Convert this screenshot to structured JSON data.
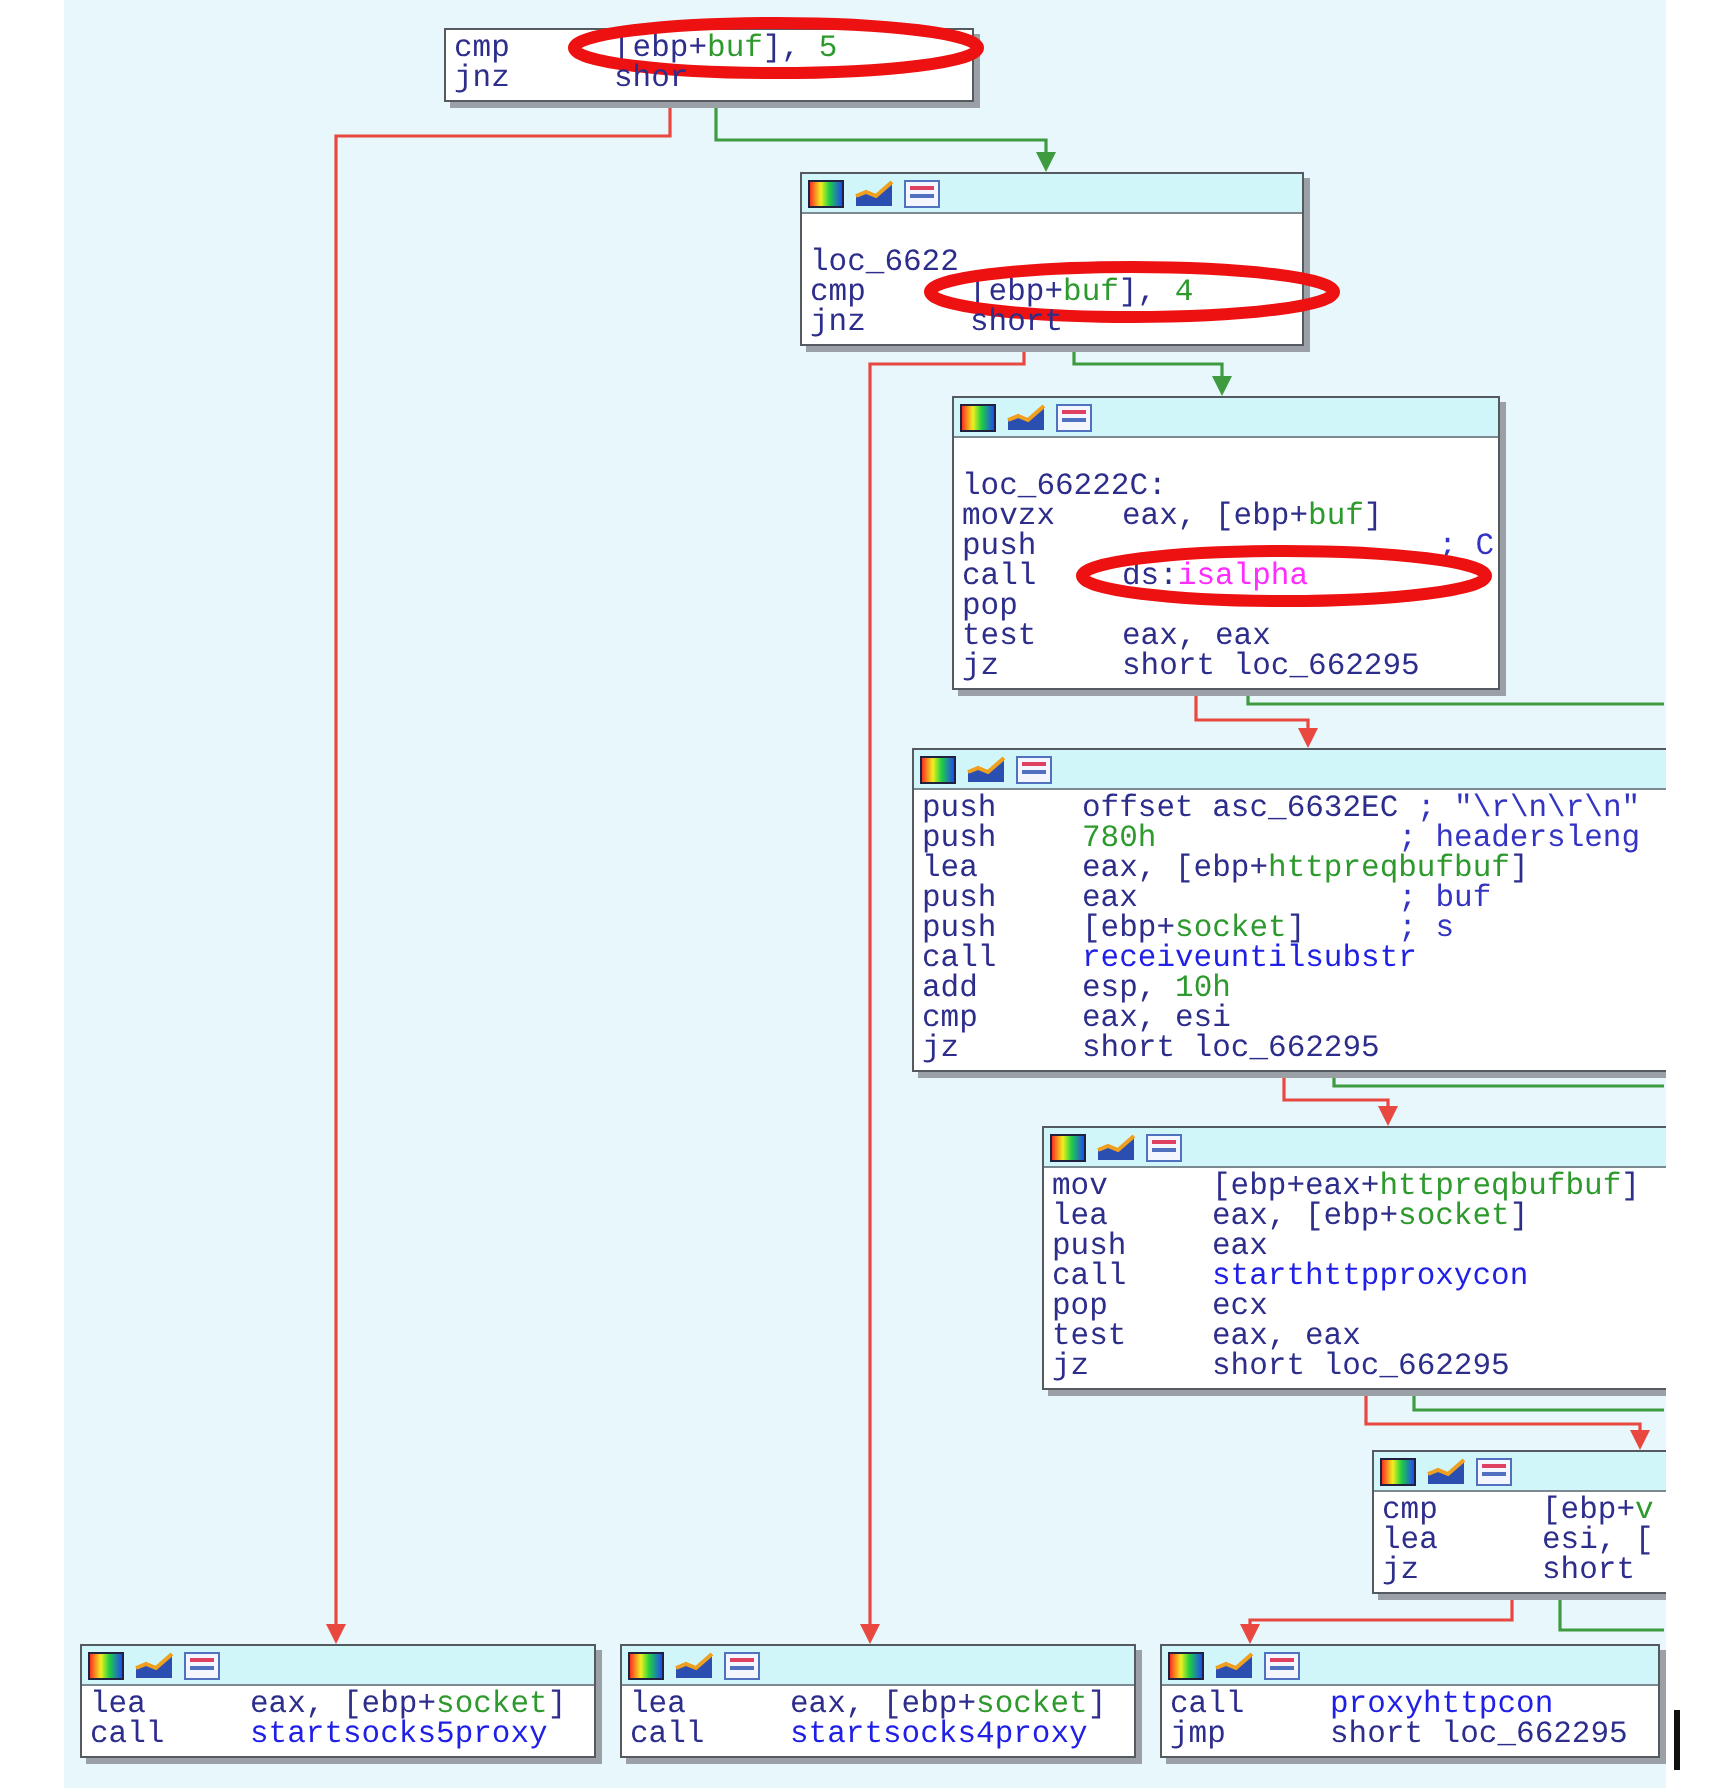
{
  "blocks": [
    {
      "header": false,
      "lines": [
        {
          "kind": "instr",
          "m": "cmp",
          "op": [
            {
              "t": "[ebp+",
              "kind": "reg"
            },
            {
              "t": "buf",
              "kind": "var"
            },
            {
              "t": "], ",
              "kind": "reg"
            },
            {
              "t": "5",
              "kind": "num"
            }
          ],
          "circled": true
        },
        {
          "kind": "instr",
          "m": "jnz",
          "op": [
            {
              "t": "shor",
              "kind": "reg"
            }
          ],
          "circled": false
        }
      ]
    },
    {
      "header": true,
      "lines": [
        {
          "kind": "blank"
        },
        {
          "kind": "label",
          "text": "loc_6622",
          "circled": false
        },
        {
          "kind": "instr",
          "m": "cmp",
          "op": [
            {
              "t": "[ebp+",
              "kind": "reg"
            },
            {
              "t": "buf",
              "kind": "var"
            },
            {
              "t": "], ",
              "kind": "reg"
            },
            {
              "t": "4",
              "kind": "num"
            }
          ],
          "circled": true
        },
        {
          "kind": "instr",
          "m": "jnz",
          "op": [
            {
              "t": "short",
              "kind": "reg"
            }
          ],
          "circled": false
        }
      ]
    },
    {
      "header": true,
      "lines": [
        {
          "kind": "blank"
        },
        {
          "kind": "label",
          "text": "loc_66222C:",
          "circled": false
        },
        {
          "kind": "instr",
          "m": "movzx",
          "op": [
            {
              "t": "eax, [ebp+",
              "kind": "reg"
            },
            {
              "t": "buf",
              "kind": "var"
            },
            {
              "t": "]",
              "kind": "reg"
            }
          ],
          "circled": false
        },
        {
          "kind": "instr",
          "m": "push",
          "c": "; C",
          "circled": false
        },
        {
          "kind": "instr",
          "m": "call",
          "op": [
            {
              "t": "ds:",
              "kind": "reg"
            },
            {
              "t": "isalpha",
              "kind": "imp"
            }
          ],
          "circled": true
        },
        {
          "kind": "instr",
          "m": "pop",
          "circled": false
        },
        {
          "kind": "instr",
          "m": "test",
          "op": [
            {
              "t": "eax, eax",
              "kind": "reg"
            }
          ],
          "circled": false
        },
        {
          "kind": "instr",
          "m": "jz",
          "op": [
            {
              "t": "short loc_662295",
              "kind": "reg"
            }
          ],
          "circled": false
        }
      ]
    },
    {
      "header": true,
      "lines": [
        {
          "kind": "instr",
          "m": "push",
          "op": [
            {
              "t": "offset asc_6632EC",
              "kind": "reg"
            }
          ],
          "c": "; \"\\r\\n\\r\\n\"",
          "circled": false
        },
        {
          "kind": "instr",
          "m": "push",
          "op": [
            {
              "t": "780h",
              "kind": "num"
            }
          ],
          "c": "; headersleng",
          "circled": false
        },
        {
          "kind": "instr",
          "m": "lea",
          "op": [
            {
              "t": "eax, [ebp+",
              "kind": "reg"
            },
            {
              "t": "httpreqbufbuf",
              "kind": "var"
            },
            {
              "t": "]",
              "kind": "reg"
            }
          ],
          "circled": false
        },
        {
          "kind": "instr",
          "m": "push",
          "op": [
            {
              "t": "eax",
              "kind": "reg"
            }
          ],
          "c": "; buf",
          "circled": false
        },
        {
          "kind": "instr",
          "m": "push",
          "op": [
            {
              "t": "[ebp+",
              "kind": "reg"
            },
            {
              "t": "socket",
              "kind": "var"
            },
            {
              "t": "]",
              "kind": "reg"
            }
          ],
          "c": "; s",
          "circled": false
        },
        {
          "kind": "instr",
          "m": "call",
          "op": [
            {
              "t": "receiveuntilsubstr",
              "kind": "func"
            }
          ],
          "circled": false
        },
        {
          "kind": "instr",
          "m": "add",
          "op": [
            {
              "t": "esp, ",
              "kind": "reg"
            },
            {
              "t": "10h",
              "kind": "num"
            }
          ],
          "circled": false
        },
        {
          "kind": "instr",
          "m": "cmp",
          "op": [
            {
              "t": "eax, esi",
              "kind": "reg"
            }
          ],
          "circled": false
        },
        {
          "kind": "instr",
          "m": "jz",
          "op": [
            {
              "t": "short loc_662295",
              "kind": "reg"
            }
          ],
          "circled": false
        }
      ]
    },
    {
      "header": true,
      "lines": [
        {
          "kind": "instr",
          "m": "mov",
          "op": [
            {
              "t": "[ebp+eax+",
              "kind": "reg"
            },
            {
              "t": "httpreqbufbuf",
              "kind": "var"
            },
            {
              "t": "]",
              "kind": "reg"
            }
          ],
          "circled": false
        },
        {
          "kind": "instr",
          "m": "lea",
          "op": [
            {
              "t": "eax, [ebp+",
              "kind": "reg"
            },
            {
              "t": "socket",
              "kind": "var"
            },
            {
              "t": "]",
              "kind": "reg"
            }
          ],
          "circled": false
        },
        {
          "kind": "instr",
          "m": "push",
          "op": [
            {
              "t": "eax",
              "kind": "reg"
            }
          ],
          "circled": false
        },
        {
          "kind": "instr",
          "m": "call",
          "op": [
            {
              "t": "starthttpproxycon",
              "kind": "func"
            }
          ],
          "circled": false
        },
        {
          "kind": "instr",
          "m": "pop",
          "op": [
            {
              "t": "ecx",
              "kind": "reg"
            }
          ],
          "circled": false
        },
        {
          "kind": "instr",
          "m": "test",
          "op": [
            {
              "t": "eax, eax",
              "kind": "reg"
            }
          ],
          "circled": false
        },
        {
          "kind": "instr",
          "m": "jz",
          "op": [
            {
              "t": "short loc_662295",
              "kind": "reg"
            }
          ],
          "circled": false
        }
      ]
    },
    {
      "header": true,
      "lines": [
        {
          "kind": "instr",
          "m": "cmp",
          "op": [
            {
              "t": "[ebp+",
              "kind": "reg"
            },
            {
              "t": "v",
              "kind": "var"
            }
          ],
          "circled": false
        },
        {
          "kind": "instr",
          "m": "lea",
          "op": [
            {
              "t": "esi, [",
              "kind": "reg"
            }
          ],
          "circled": false
        },
        {
          "kind": "instr",
          "m": "jz",
          "op": [
            {
              "t": "short",
              "kind": "reg"
            }
          ],
          "circled": false
        }
      ]
    },
    {
      "header": true,
      "lines": [
        {
          "kind": "instr",
          "m": "lea",
          "op": [
            {
              "t": "eax, [ebp+",
              "kind": "reg"
            },
            {
              "t": "socket",
              "kind": "var"
            },
            {
              "t": "]",
              "kind": "reg"
            }
          ],
          "circled": false
        },
        {
          "kind": "instr",
          "m": "call",
          "op": [
            {
              "t": "startsocks5proxy",
              "kind": "func"
            }
          ],
          "circled": false
        }
      ]
    },
    {
      "header": true,
      "lines": [
        {
          "kind": "instr",
          "m": "lea",
          "op": [
            {
              "t": "eax, [ebp+",
              "kind": "reg"
            },
            {
              "t": "socket",
              "kind": "var"
            },
            {
              "t": "]",
              "kind": "reg"
            }
          ],
          "circled": false
        },
        {
          "kind": "instr",
          "m": "call",
          "op": [
            {
              "t": "startsocks4proxy",
              "kind": "func"
            }
          ],
          "circled": false
        }
      ]
    },
    {
      "header": true,
      "lines": [
        {
          "kind": "instr",
          "m": "call",
          "op": [
            {
              "t": "proxyhttpcon",
              "kind": "func"
            }
          ],
          "circled": false
        },
        {
          "kind": "instr",
          "m": "jmp",
          "op": [
            {
              "t": "short loc_662295",
              "kind": "reg"
            }
          ],
          "circled": false
        }
      ]
    }
  ],
  "edges": [
    {
      "color": "#e8483f"
    },
    {
      "color": "#3f9b3f"
    },
    {
      "color": "#e8483f"
    },
    {
      "color": "#3f9b3f"
    },
    {
      "color": "#e8483f"
    },
    {
      "color": "#3f9b3f"
    },
    {
      "color": "#e8483f"
    },
    {
      "color": "#3f9b3f"
    },
    {
      "color": "#e8483f"
    },
    {
      "color": "#3f9b3f"
    },
    {
      "color": "#e8483f"
    },
    {
      "color": "#3f9b3f"
    }
  ]
}
